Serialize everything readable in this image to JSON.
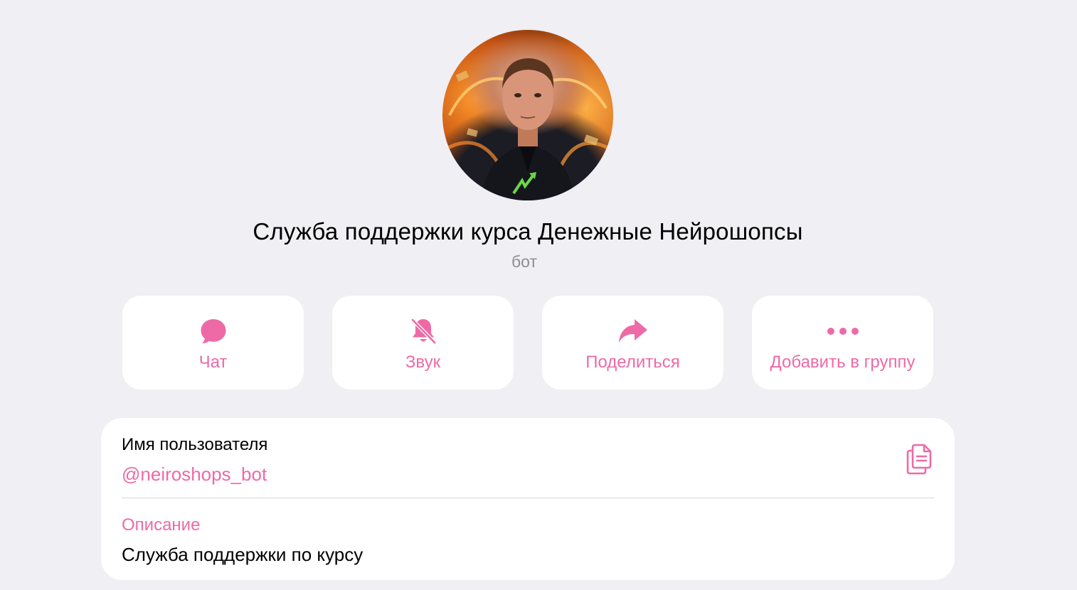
{
  "profile": {
    "name": "Служба поддержки курса Денежные Нейрошопсы",
    "type": "бот"
  },
  "actions": [
    {
      "label": "Чат",
      "icon": "chat-bubble-icon"
    },
    {
      "label": "Звук",
      "icon": "bell-muted-icon"
    },
    {
      "label": "Поделиться",
      "icon": "share-arrow-icon"
    },
    {
      "label": "Добавить в группу",
      "icon": "more-dots-icon"
    }
  ],
  "info": {
    "username_label": "Имя пользователя",
    "username_value": "@neiroshops_bot",
    "copy_icon": "copy-icon",
    "description_label": "Описание",
    "description_value": "Служба поддержки по курсу"
  },
  "colors": {
    "accent": "#ee6aa7",
    "background": "#efeff4",
    "card": "#ffffff",
    "secondary_text": "#8e8e93"
  }
}
